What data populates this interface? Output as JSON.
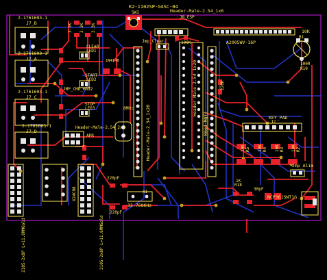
{
  "colors": {
    "background": "#000000",
    "outline": "#b018c8",
    "top_trace": "#e8222a",
    "bottom_trace": "#2233c8",
    "silk": "#ffe95a",
    "pad": "#e6e6e6",
    "via": "#c8a020"
  },
  "labels": {
    "sw1_part": "K2-1102SP-G4SC-04",
    "sw1_ref": "SW1",
    "hdr_top": "Header-Male-2.54_1x6",
    "hdr_top_ref": "J8_ESP",
    "j7b_part": "2-1761603-1",
    "j7b_ref": "J7_B",
    "j7a_part": "2-1761603-1",
    "j7a_ref": "J7_A",
    "j7c_part": "2-1761603-1",
    "j7c_ref": "J7_C",
    "j7d_part": "2-1761603-1",
    "j7d_ref": "J7_D",
    "r3k3_1": "3.3K",
    "r3k3_2": "3.3K",
    "r3k3_3": "3.3K",
    "clear": "CLEAR",
    "led1": "LED1",
    "jmp_clear": "Jmp_Clear",
    "n4148": "1N4148",
    "r100k": "100K",
    "a2005": "A2005WV-16P",
    "pot_10k": "10K",
    "pot_r1": "R1",
    "r100r": "100R",
    "r_r10": "R10",
    "start": "START",
    "led2": "LED2",
    "jmp_cmd": "JMP_CMD_Mod2",
    "stop": "STOP",
    "led3": "LED3",
    "bmhz": "8MHz",
    "hdr_2x3": "Header-Male-2.54_2x3",
    "apr": "APR",
    "hdr_1x20a": "Header-Male-2.54_1x20",
    "hdr_1x20b": "Header-Male-2.54_1x20",
    "esp_mod": "Kmod-MQTT",
    "r220k": "220K",
    "key_pad": "KEY_PAD",
    "key_j2": "J2",
    "r10k_1": "10K",
    "r10k_2": "10K",
    "r10k_3": "10K",
    "r10k_4": "10K",
    "r_r5": "R5",
    "r_r4": "R4",
    "r_r3": "R3",
    "r_r2": "R2",
    "jmp_alim": "Jmp_Alim",
    "x2_chip": "X24C08",
    "c220p_1": "220pF",
    "c220p_2": "220pF",
    "xtal": "32.768KHz",
    "xtal_ref": "X1",
    "r1k": "1K",
    "r18": "R18",
    "c30p": "30pF",
    "ncp": "NCP361SNT1G",
    "hdr_left_1": "2105-2x8P L=11.6MMGold",
    "hdr_left_2": "2105-2x8P L=11.6MMGold"
  }
}
